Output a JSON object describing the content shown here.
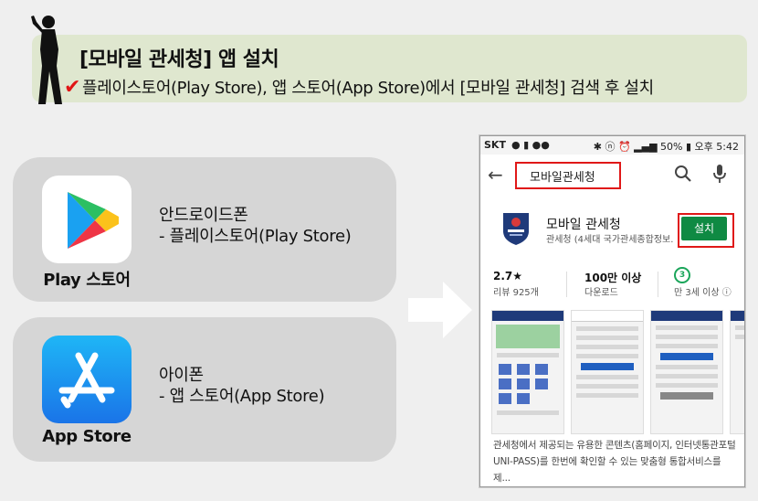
{
  "banner": {
    "title": "[모바일 관세청] 앱 설치",
    "subtitle": "플레이스토어(Play Store), 앱 스토어(App Store)에서 [모바일 관세청] 검색 후 설치",
    "check_color": "#e01515"
  },
  "cards": [
    {
      "app_name": "Play 스토어",
      "icon": "play-store-icon",
      "line1": "안드로이드폰",
      "line2": "- 플레이스토어(Play Store)"
    },
    {
      "app_name": "App Store",
      "icon": "app-store-icon",
      "line1": "아이폰",
      "line2": "- 앱 스토어(App Store)"
    }
  ],
  "phone": {
    "status": {
      "carrier": "SKT",
      "battery": "50%",
      "time": "오후 5:42"
    },
    "search": {
      "query": "모바일관세청"
    },
    "app": {
      "title": "모바일 관세청",
      "developer": "관세청 (4세대 국가관세종합정보...",
      "install_label": "설치",
      "install_color": "#0f8a43"
    },
    "stats": {
      "rating": "2.7★",
      "reviews": "리뷰 925개",
      "downloads": "100만 이상",
      "downloads_label": "다운로드",
      "age": "3",
      "age_label": "만 3세 이상 ⓘ"
    },
    "description": "관세청에서 제공되는 유용한 콘텐츠(홈페이지, 인터넷통관포털 UNI-PASS)를 한번에 확인할 수 있는 맞춤형 통합서비스를 제..."
  }
}
